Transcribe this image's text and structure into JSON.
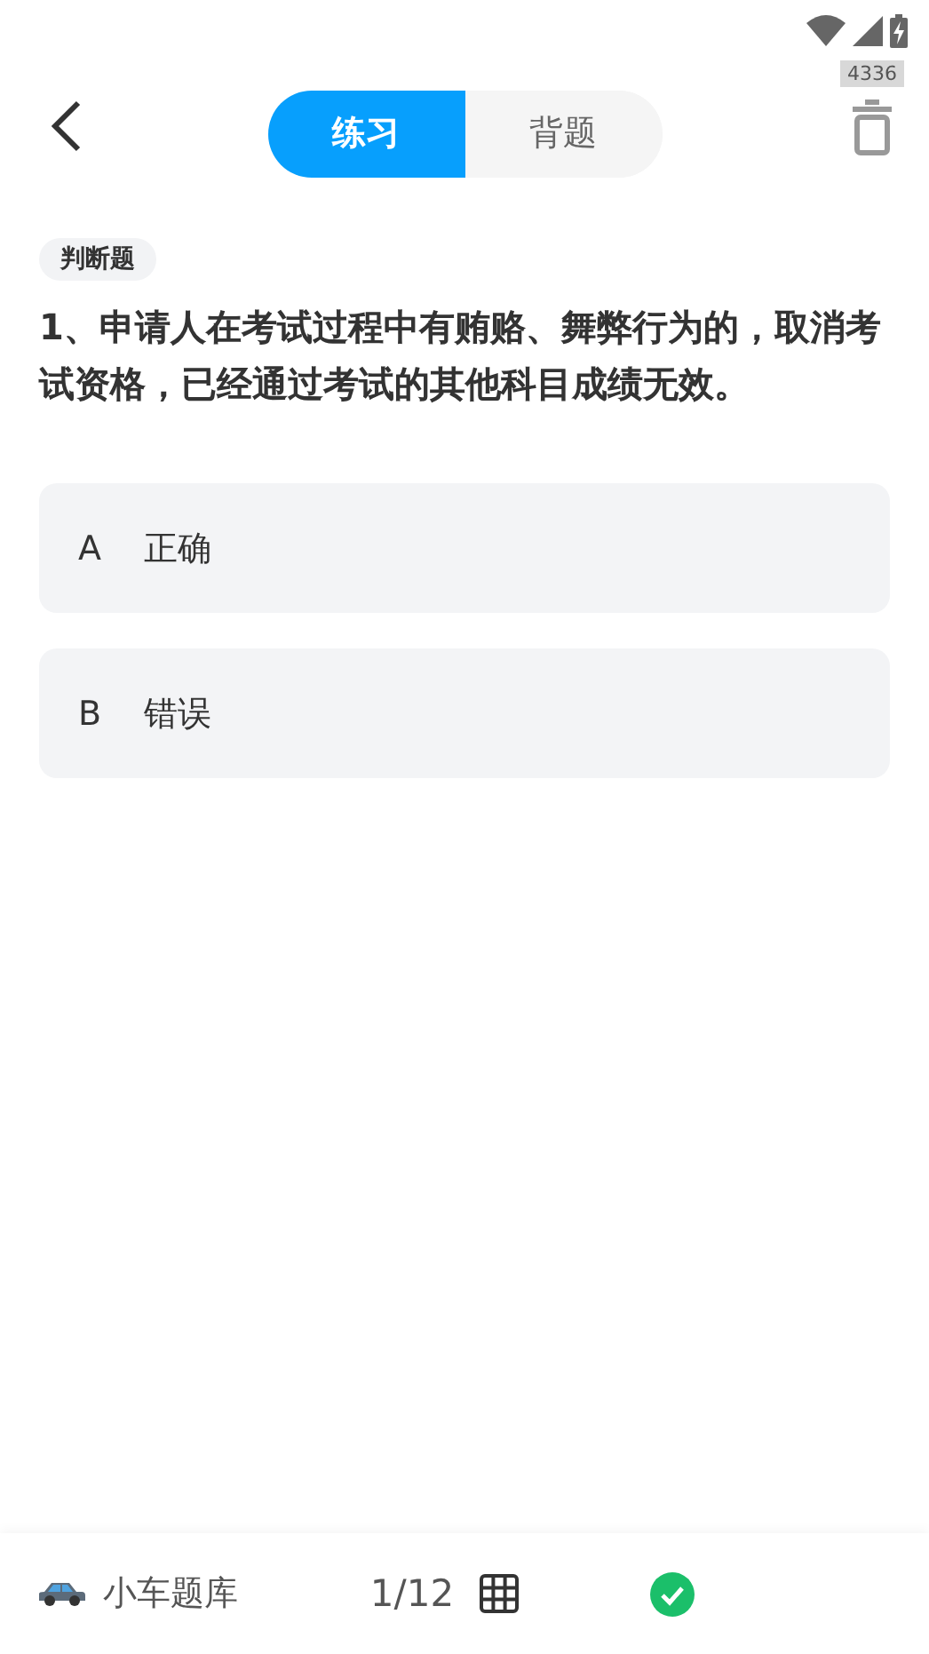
{
  "badge_text": "4336",
  "tabs": [
    {
      "label": "练习",
      "selected": true
    },
    {
      "label": "背题",
      "selected": false
    }
  ],
  "question": {
    "type_tag": "判断题",
    "text": "1、申请人在考试过程中有贿赂、舞弊行为的，取消考试资格，已经通过考试的其他科目成绩无效。"
  },
  "options": [
    {
      "letter": "A",
      "label": "正确",
      "selected": false
    },
    {
      "letter": "B",
      "label": "错误",
      "selected": false
    }
  ],
  "bottom_bar": {
    "bank": "小车题库",
    "progress": "1/12"
  }
}
